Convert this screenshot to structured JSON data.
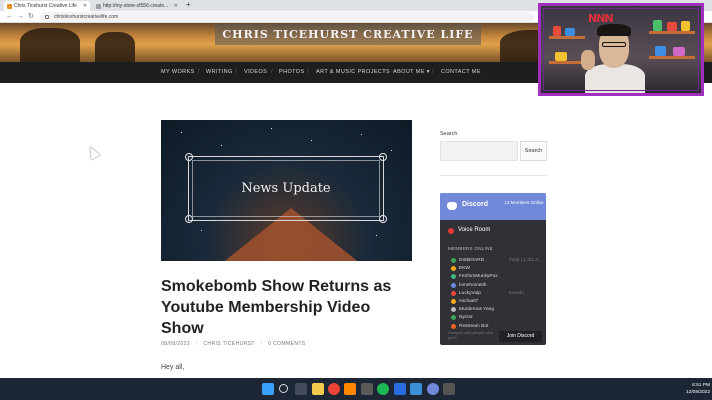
{
  "browser": {
    "tabs": [
      {
        "title": "Chris Ticehurst Creative Life"
      },
      {
        "title": "http://my-store-cf556.creato..."
      }
    ],
    "new_tab": "+",
    "url": "christicehurstcreativelife.com"
  },
  "site": {
    "title": "CHRIS TICEHURST CREATIVE LIFE",
    "nav": [
      "MY WORKS",
      "WRITING",
      "VIDEOS",
      "PHOTOS",
      "ART & MUSIC PROJECTS",
      "ABOUT ME",
      "CONTACT ME"
    ],
    "nav_dropdown_icon": "chevron-down-icon"
  },
  "post": {
    "featured_image_text": "News Update",
    "title": "Smokebomb Show Returns as Youtube Membership Video Show",
    "date": "08/08/2022",
    "author": "CHRIS TICEHURST",
    "comments": "0 COMMENTS",
    "body_start": "Hey all,"
  },
  "sidebar": {
    "search_label": "Search",
    "search_button": "Search"
  },
  "discord": {
    "brand": "Discord",
    "online": "13 Members Online",
    "voice_room": "Voice Room",
    "members_label": "MEMBERS ONLINE",
    "members": [
      {
        "name": "DISBOARD",
        "game": "/help | 1,3/1,3...",
        "color": "#3ba55c"
      },
      {
        "name": "EKW",
        "game": "",
        "color": "#faa61a"
      },
      {
        "name": "FenfomMunkyPox",
        "game": "",
        "color": "#43b581"
      },
      {
        "name": "lomehomeith",
        "game": "",
        "color": "#7289da"
      },
      {
        "name": "LuckyVulp",
        "game": "Kenshi",
        "color": "#f04747"
      },
      {
        "name": "michael7",
        "game": "",
        "color": "#faa61a"
      },
      {
        "name": "Murderous Yang",
        "game": "",
        "color": "#b9bbbe"
      },
      {
        "name": "Nyctor",
        "game": "",
        "color": "#3ba55c"
      },
      {
        "name": "Restream Bot",
        "game": "",
        "color": "#f26522"
      }
    ],
    "footer": "Hangout with people who get it",
    "join": "Join Discord"
  },
  "webcam": {
    "logo": "NNN"
  },
  "taskbar": {
    "time": "6:51 PM",
    "date": "12/08/2022"
  },
  "colors": {
    "discord_header": "#7289da",
    "discord_bg": "#2f3136",
    "webcam_border": "#a02fbf",
    "nav_bg": "#1e1e1e",
    "taskbar_bg": "#1c2634"
  }
}
